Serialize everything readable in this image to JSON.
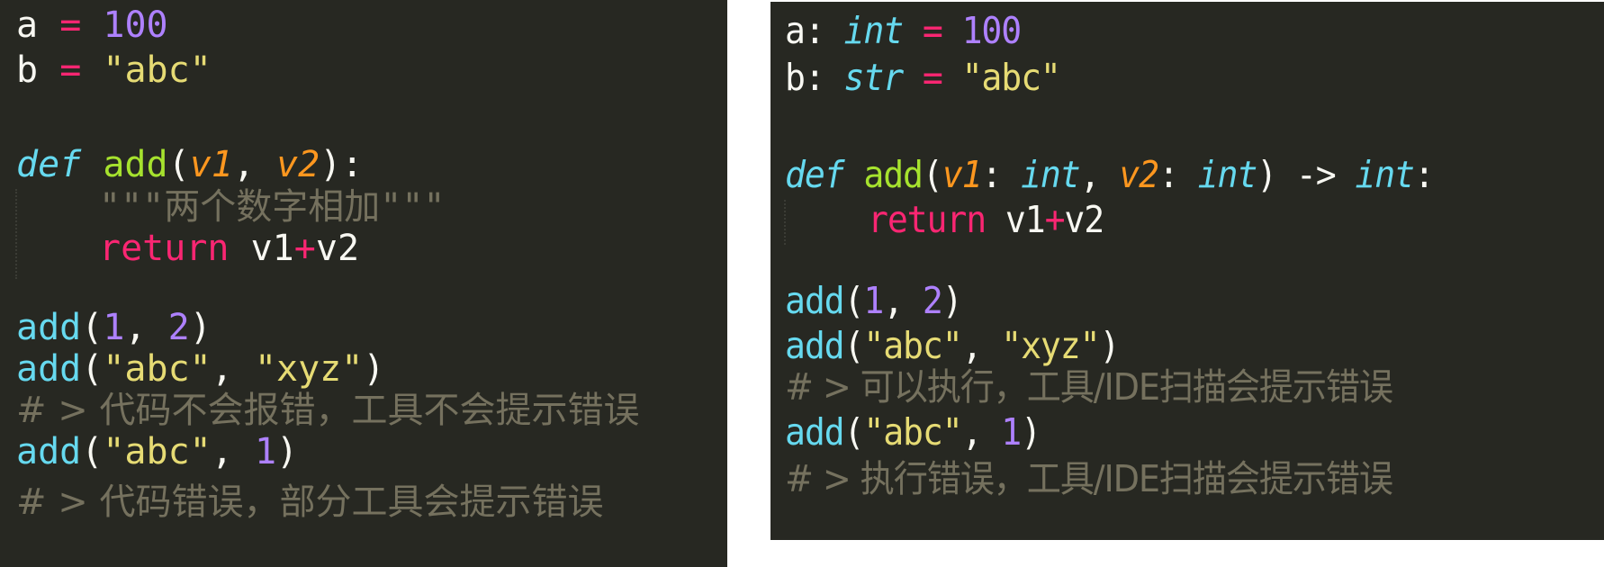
{
  "colors": {
    "background": "#272822",
    "plain": "#f8f8f2",
    "keyword_operator": "#f92672",
    "number": "#ae81ff",
    "string": "#e6db74",
    "storage_type": "#66d9ef",
    "function_name": "#a6e22e",
    "parameter": "#fd971f",
    "comment": "#75715e"
  },
  "left": {
    "line1": {
      "name": "a",
      "op": "=",
      "value": "100"
    },
    "line2": {
      "name": "b",
      "op": "=",
      "value": "\"abc\""
    },
    "line4": {
      "kw": "def",
      "fn": "add",
      "open": "(",
      "p1": "v1",
      "sep": ", ",
      "p2": "v2",
      "close": "):"
    },
    "line5": {
      "doc": "\"\"\"两个数字相加\"\"\""
    },
    "line6": {
      "kw": "return",
      "a": "v1",
      "op": "+",
      "b": "v2"
    },
    "line8": {
      "fn": "add",
      "open": "(",
      "a1": "1",
      "sep": ", ",
      "a2": "2",
      "close": ")"
    },
    "line9": {
      "fn": "add",
      "open": "(",
      "a1": "\"abc\"",
      "sep": ", ",
      "a2": "\"xyz\"",
      "close": ")"
    },
    "line10": {
      "comment": "# > 代码不会报错，工具不会提示错误"
    },
    "line11": {
      "fn": "add",
      "open": "(",
      "a1": "\"abc\"",
      "sep": ", ",
      "a2": "1",
      "close": ")"
    },
    "line12": {
      "comment": "# > 代码错误，部分工具会提示错误"
    }
  },
  "right": {
    "line1": {
      "name": "a",
      "colon": ": ",
      "type": "int",
      "op": "=",
      "value": "100"
    },
    "line2": {
      "name": "b",
      "colon": ": ",
      "type": "str",
      "op": "=",
      "value": "\"abc\""
    },
    "line4": {
      "kw": "def",
      "fn": "add",
      "open": "(",
      "p1": "v1",
      "c1": ": ",
      "t1": "int",
      "sep": ", ",
      "p2": "v2",
      "c2": ": ",
      "t2": "int",
      "close": ") -> ",
      "rt": "int",
      "end": ":"
    },
    "line5": {
      "kw": "return",
      "a": "v1",
      "op": "+",
      "b": "v2"
    },
    "line7": {
      "fn": "add",
      "open": "(",
      "a1": "1",
      "sep": ", ",
      "a2": "2",
      "close": ")"
    },
    "line8": {
      "fn": "add",
      "open": "(",
      "a1": "\"abc\"",
      "sep": ", ",
      "a2": "\"xyz\"",
      "close": ")"
    },
    "line9": {
      "comment": "# > 可以执行，工具/IDE扫描会提示错误"
    },
    "line10": {
      "fn": "add",
      "open": "(",
      "a1": "\"abc\"",
      "sep": ", ",
      "a2": "1",
      "close": ")"
    },
    "line11": {
      "comment": "# > 执行错误，工具/IDE扫描会提示错误"
    }
  }
}
